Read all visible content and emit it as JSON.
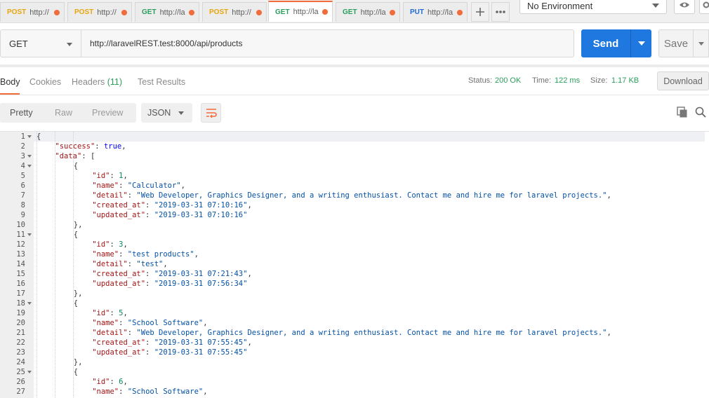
{
  "tabs": [
    {
      "method": "POST",
      "url": "http://",
      "active": false
    },
    {
      "method": "POST",
      "url": "http://",
      "active": false
    },
    {
      "method": "GET",
      "url": "http://la",
      "active": false
    },
    {
      "method": "POST",
      "url": "http://",
      "active": false
    },
    {
      "method": "GET",
      "url": "http://la",
      "active": true
    },
    {
      "method": "GET",
      "url": "http://la",
      "active": false
    },
    {
      "method": "PUT",
      "url": "http://la",
      "active": false
    }
  ],
  "environment": {
    "selected": "No Environment"
  },
  "request": {
    "method": "GET",
    "url": "http://laravelREST.test:8000/api/products",
    "send_label": "Send",
    "save_label": "Save"
  },
  "response_tabs": [
    {
      "label": "Body"
    },
    {
      "label": "Cookies"
    },
    {
      "label": "Headers",
      "count": "(11)"
    },
    {
      "label": "Test Results"
    }
  ],
  "response_meta": {
    "status_label": "Status:",
    "status_value": "200 OK",
    "time_label": "Time:",
    "time_value": "122 ms",
    "size_label": "Size:",
    "size_value": "1.17 KB",
    "download_label": "Download"
  },
  "view_modes": [
    "Pretty",
    "Raw",
    "Preview"
  ],
  "language": "JSON",
  "colors": {
    "accent": "#f26b3a",
    "primary": "#1f77e0",
    "success": "#2a9d5c"
  },
  "code_lines": [
    {
      "n": "1",
      "fold": true,
      "i": 0,
      "t": [
        [
          "p",
          "{"
        ]
      ]
    },
    {
      "n": "2",
      "fold": false,
      "i": 1,
      "t": [
        [
          "k",
          "\"success\""
        ],
        [
          "p",
          ": "
        ],
        [
          "b",
          "true"
        ],
        [
          "p",
          ","
        ]
      ]
    },
    {
      "n": "3",
      "fold": true,
      "i": 1,
      "t": [
        [
          "k",
          "\"data\""
        ],
        [
          "p",
          ": ["
        ]
      ]
    },
    {
      "n": "4",
      "fold": true,
      "i": 2,
      "t": [
        [
          "p",
          "{"
        ]
      ]
    },
    {
      "n": "5",
      "fold": false,
      "i": 3,
      "t": [
        [
          "k",
          "\"id\""
        ],
        [
          "p",
          ": "
        ],
        [
          "n",
          "1"
        ],
        [
          "p",
          ","
        ]
      ]
    },
    {
      "n": "6",
      "fold": false,
      "i": 3,
      "t": [
        [
          "k",
          "\"name\""
        ],
        [
          "p",
          ": "
        ],
        [
          "s",
          "\"Calculator\""
        ],
        [
          "p",
          ","
        ]
      ]
    },
    {
      "n": "7",
      "fold": false,
      "i": 3,
      "t": [
        [
          "k",
          "\"detail\""
        ],
        [
          "p",
          ": "
        ],
        [
          "s",
          "\"Web Developer, Graphics Designer, and a writing enthusiast. Contact me and hire me for laravel projects.\""
        ],
        [
          "p",
          ","
        ]
      ]
    },
    {
      "n": "8",
      "fold": false,
      "i": 3,
      "t": [
        [
          "k",
          "\"created_at\""
        ],
        [
          "p",
          ": "
        ],
        [
          "s",
          "\"2019-03-31 07:10:16\""
        ],
        [
          "p",
          ","
        ]
      ]
    },
    {
      "n": "9",
      "fold": false,
      "i": 3,
      "t": [
        [
          "k",
          "\"updated_at\""
        ],
        [
          "p",
          ": "
        ],
        [
          "s",
          "\"2019-03-31 07:10:16\""
        ]
      ]
    },
    {
      "n": "10",
      "fold": false,
      "i": 2,
      "t": [
        [
          "p",
          "},"
        ]
      ]
    },
    {
      "n": "11",
      "fold": true,
      "i": 2,
      "t": [
        [
          "p",
          "{"
        ]
      ]
    },
    {
      "n": "12",
      "fold": false,
      "i": 3,
      "t": [
        [
          "k",
          "\"id\""
        ],
        [
          "p",
          ": "
        ],
        [
          "n",
          "3"
        ],
        [
          "p",
          ","
        ]
      ]
    },
    {
      "n": "13",
      "fold": false,
      "i": 3,
      "t": [
        [
          "k",
          "\"name\""
        ],
        [
          "p",
          ": "
        ],
        [
          "s",
          "\"test products\""
        ],
        [
          "p",
          ","
        ]
      ]
    },
    {
      "n": "14",
      "fold": false,
      "i": 3,
      "t": [
        [
          "k",
          "\"detail\""
        ],
        [
          "p",
          ": "
        ],
        [
          "s",
          "\"test\""
        ],
        [
          "p",
          ","
        ]
      ]
    },
    {
      "n": "15",
      "fold": false,
      "i": 3,
      "t": [
        [
          "k",
          "\"created_at\""
        ],
        [
          "p",
          ": "
        ],
        [
          "s",
          "\"2019-03-31 07:21:43\""
        ],
        [
          "p",
          ","
        ]
      ]
    },
    {
      "n": "16",
      "fold": false,
      "i": 3,
      "t": [
        [
          "k",
          "\"updated_at\""
        ],
        [
          "p",
          ": "
        ],
        [
          "s",
          "\"2019-03-31 07:56:34\""
        ]
      ]
    },
    {
      "n": "17",
      "fold": false,
      "i": 2,
      "t": [
        [
          "p",
          "},"
        ]
      ]
    },
    {
      "n": "18",
      "fold": true,
      "i": 2,
      "t": [
        [
          "p",
          "{"
        ]
      ]
    },
    {
      "n": "19",
      "fold": false,
      "i": 3,
      "t": [
        [
          "k",
          "\"id\""
        ],
        [
          "p",
          ": "
        ],
        [
          "n",
          "5"
        ],
        [
          "p",
          ","
        ]
      ]
    },
    {
      "n": "20",
      "fold": false,
      "i": 3,
      "t": [
        [
          "k",
          "\"name\""
        ],
        [
          "p",
          ": "
        ],
        [
          "s",
          "\"School Software\""
        ],
        [
          "p",
          ","
        ]
      ]
    },
    {
      "n": "21",
      "fold": false,
      "i": 3,
      "t": [
        [
          "k",
          "\"detail\""
        ],
        [
          "p",
          ": "
        ],
        [
          "s",
          "\"Web Developer, Graphics Designer, and a writing enthusiast. Contact me and hire me for laravel projects.\""
        ],
        [
          "p",
          ","
        ]
      ]
    },
    {
      "n": "22",
      "fold": false,
      "i": 3,
      "t": [
        [
          "k",
          "\"created_at\""
        ],
        [
          "p",
          ": "
        ],
        [
          "s",
          "\"2019-03-31 07:55:45\""
        ],
        [
          "p",
          ","
        ]
      ]
    },
    {
      "n": "23",
      "fold": false,
      "i": 3,
      "t": [
        [
          "k",
          "\"updated_at\""
        ],
        [
          "p",
          ": "
        ],
        [
          "s",
          "\"2019-03-31 07:55:45\""
        ]
      ]
    },
    {
      "n": "24",
      "fold": false,
      "i": 2,
      "t": [
        [
          "p",
          "},"
        ]
      ]
    },
    {
      "n": "25",
      "fold": true,
      "i": 2,
      "t": [
        [
          "p",
          "{"
        ]
      ]
    },
    {
      "n": "26",
      "fold": false,
      "i": 3,
      "t": [
        [
          "k",
          "\"id\""
        ],
        [
          "p",
          ": "
        ],
        [
          "n",
          "6"
        ],
        [
          "p",
          ","
        ]
      ]
    },
    {
      "n": "27",
      "fold": false,
      "i": 3,
      "t": [
        [
          "k",
          "\"name\""
        ],
        [
          "p",
          ": "
        ],
        [
          "s",
          "\"School Software\""
        ],
        [
          "p",
          ","
        ]
      ]
    }
  ]
}
